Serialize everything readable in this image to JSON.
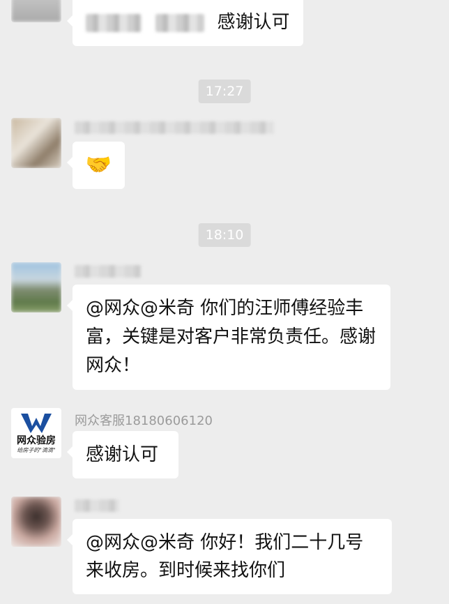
{
  "messages": [
    {
      "text": "感谢认可"
    },
    {
      "time": "17:27"
    },
    {
      "emoji": "🤝"
    },
    {
      "time": "18:10"
    },
    {
      "text": "@网众@米奇  你们的汪师傅经验丰富，关键是对客户非常负责任。感谢网众！"
    },
    {
      "sender": "网众客服18180606120",
      "text": "感谢认可",
      "logo": {
        "brand": "网众验房",
        "slogan": "给房子的\"滴滴\""
      }
    },
    {
      "text": "@网众@米奇  你好！我们二十几号来收房。到时候来找你们"
    }
  ],
  "colors": {
    "background": "#ededed",
    "bubble": "#ffffff",
    "logo_blue": "#1b4fa0",
    "time_bg": "#dadada"
  }
}
